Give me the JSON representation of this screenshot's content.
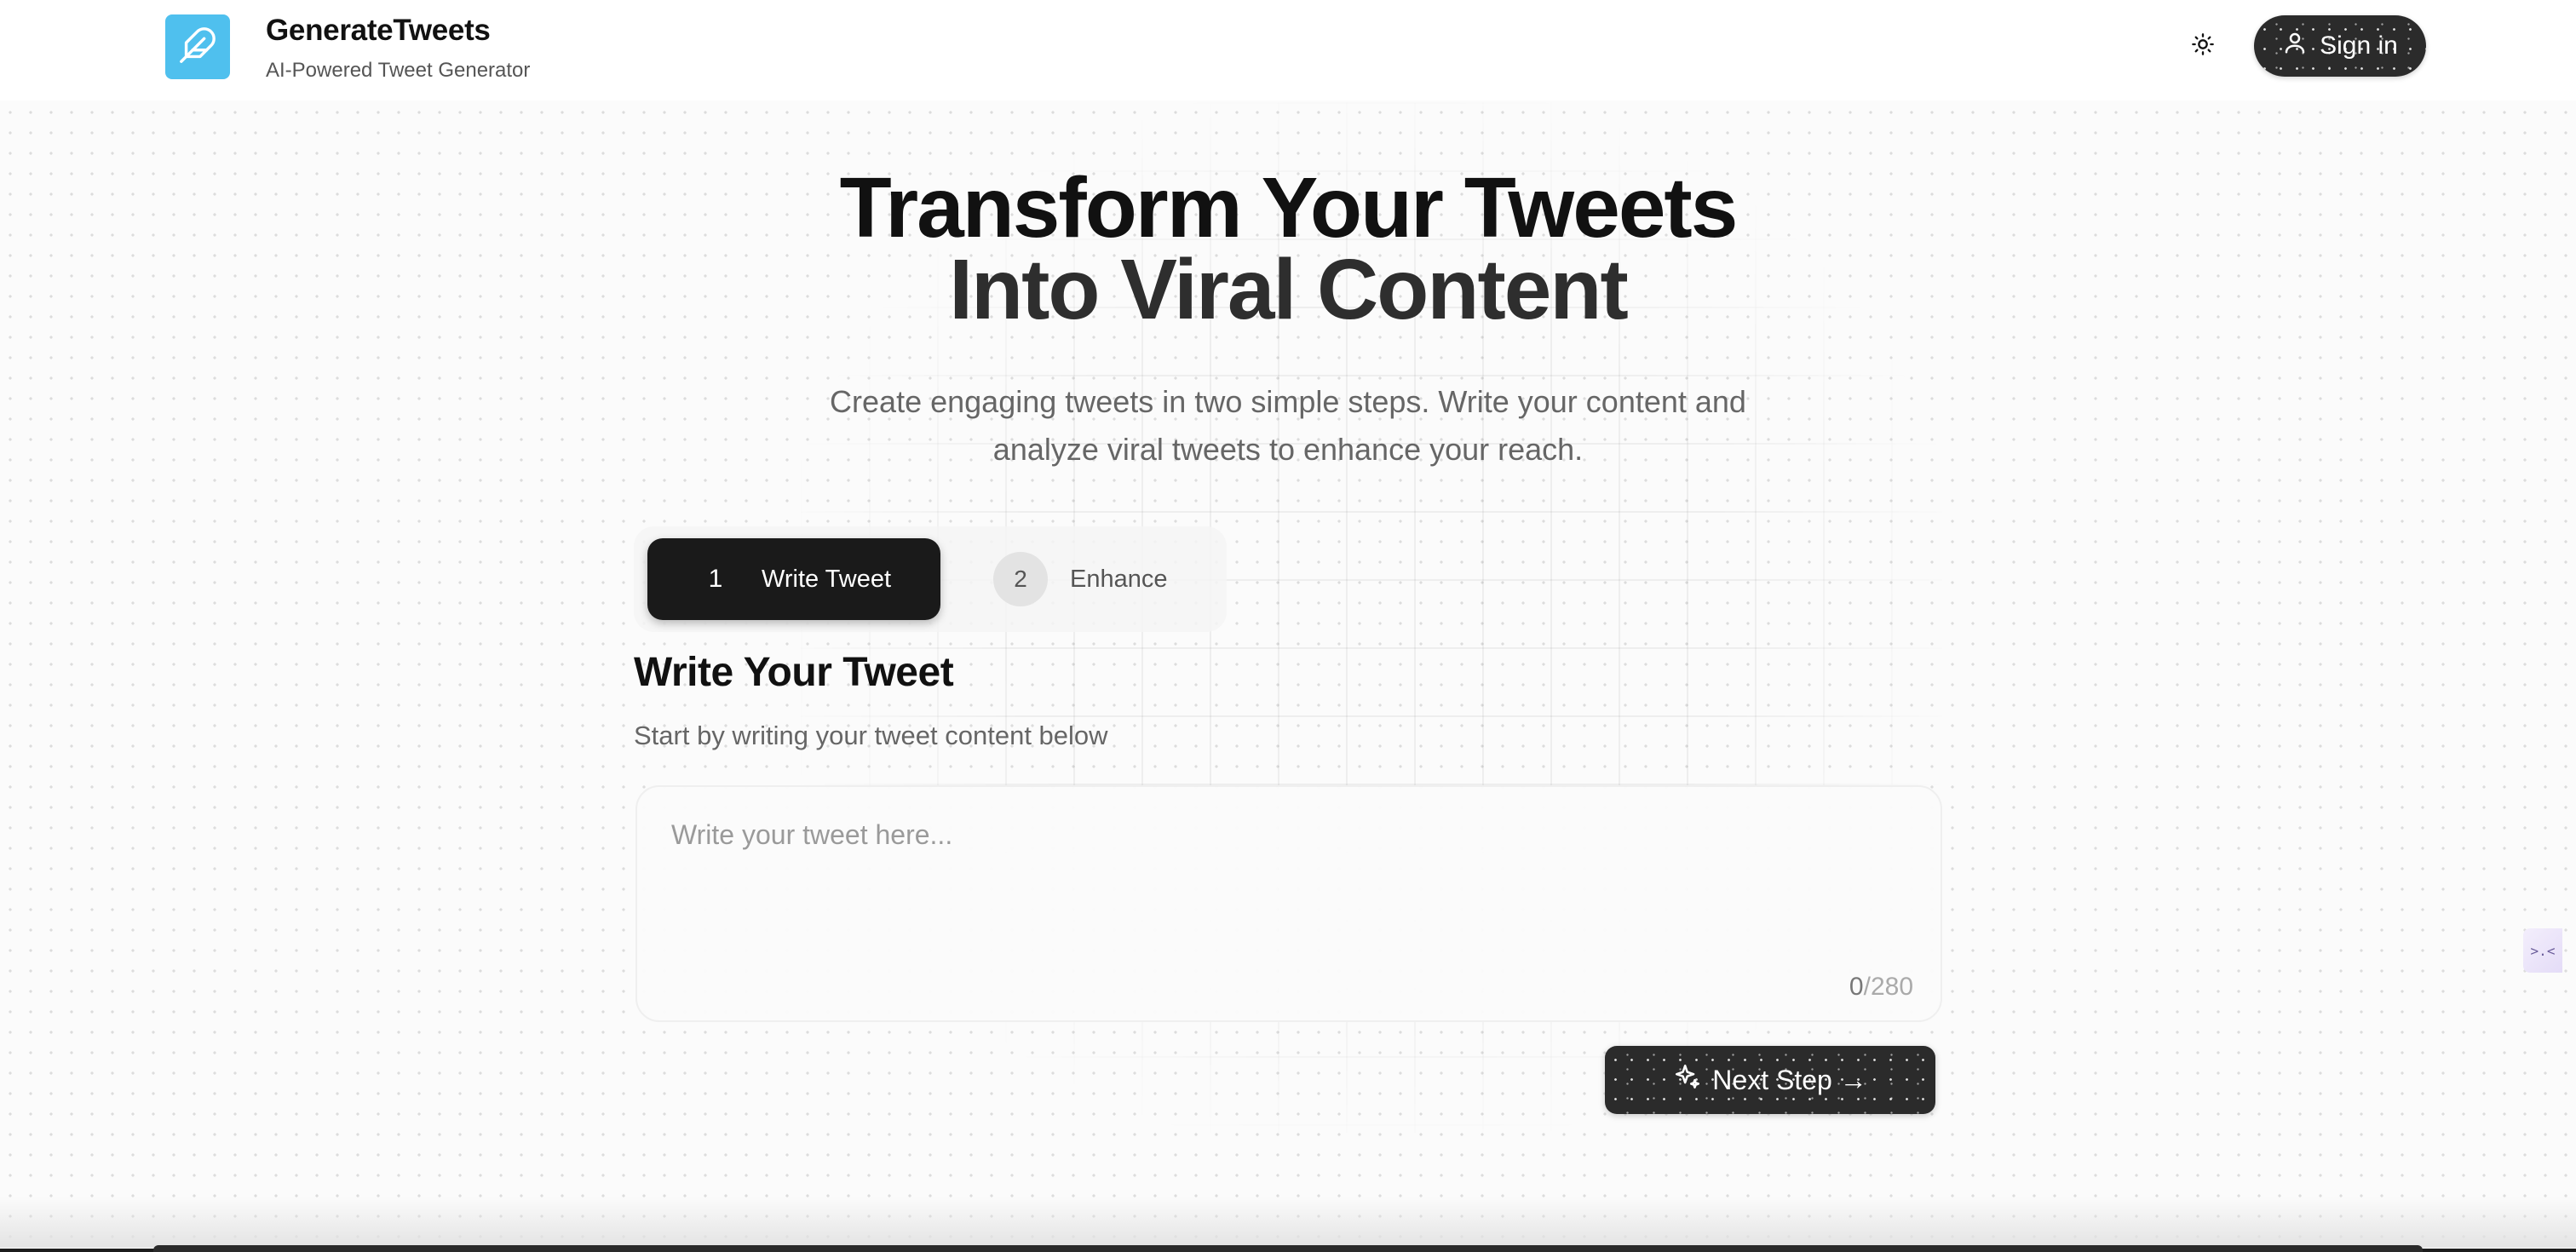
{
  "header": {
    "brand_name": "GenerateTweets",
    "brand_tagline": "AI-Powered Tweet Generator",
    "logo_icon": "feather-icon",
    "theme_toggle_icon": "sun-icon",
    "signin_label": "Sign in",
    "signin_icon": "user-icon"
  },
  "hero": {
    "title_line1": "Transform Your Tweets",
    "title_line2": "Into Viral Content",
    "subtitle_line1": "Create engaging tweets in two simple steps. Write your content and",
    "subtitle_line2": "analyze viral tweets to enhance your reach."
  },
  "steps": [
    {
      "number": "1",
      "label": "Write Tweet",
      "active": true
    },
    {
      "number": "2",
      "label": "Enhance",
      "active": false
    }
  ],
  "form": {
    "title": "Write Your Tweet",
    "subtitle": "Start by writing your tweet content below",
    "input_placeholder": "Write your tweet here...",
    "input_value": "",
    "char_count": "0",
    "char_limit": "/280",
    "next_label": "Next Step →",
    "next_icon": "sparkles-icon"
  },
  "side_widget": {
    "text": ">.<"
  },
  "colors": {
    "logo_bg": "#4fc0ee",
    "dark_button": "#2b2b2b",
    "active_step": "#1a1a1a"
  }
}
